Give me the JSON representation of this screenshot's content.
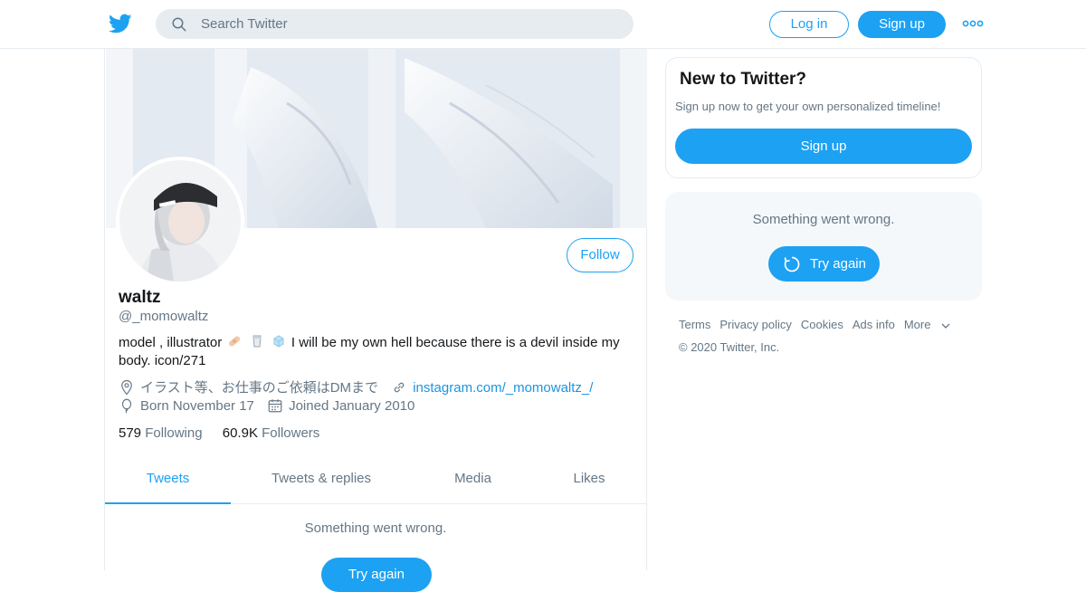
{
  "topbar": {
    "logo_icon": "twitter-bird-icon",
    "search_placeholder": "Search Twitter",
    "login_label": "Log in",
    "signup_label": "Sign up",
    "more_icon": "more-dots-icon"
  },
  "profile": {
    "name": "waltz",
    "handle": "@_momowaltz",
    "follow_label": "Follow",
    "bio_pre": "model , illustrator",
    "bio_post": "I will be my own hell because there is a devil inside my body.  icon/271",
    "location": "イラスト等、お仕事のご依頼はDMまで",
    "website": "instagram.com/_momowaltz_/",
    "birthday": "Born November 17",
    "joined": "Joined January 2010",
    "following_count": "579",
    "following_label": "Following",
    "followers_count": "60.9K",
    "followers_label": "Followers"
  },
  "tabs": [
    {
      "label": "Tweets",
      "active": true
    },
    {
      "label": "Tweets & replies",
      "active": false
    },
    {
      "label": "Media",
      "active": false
    },
    {
      "label": "Likes",
      "active": false
    }
  ],
  "timeline": {
    "error_message": "Something went wrong.",
    "retry_label": "Try again"
  },
  "sidebar": {
    "new_title": "New to Twitter?",
    "new_subtitle": "Sign up now to get your own personalized timeline!",
    "new_signup_label": "Sign up",
    "error_message": "Something went wrong.",
    "retry_label": "Try again"
  },
  "footer": {
    "links": [
      "Terms",
      "Privacy policy",
      "Cookies",
      "Ads info",
      "More"
    ],
    "copyright": "© 2020 Twitter, Inc."
  },
  "colors": {
    "accent": "#1da1f2",
    "muted_text": "#657786",
    "border": "#e6ecf0"
  }
}
